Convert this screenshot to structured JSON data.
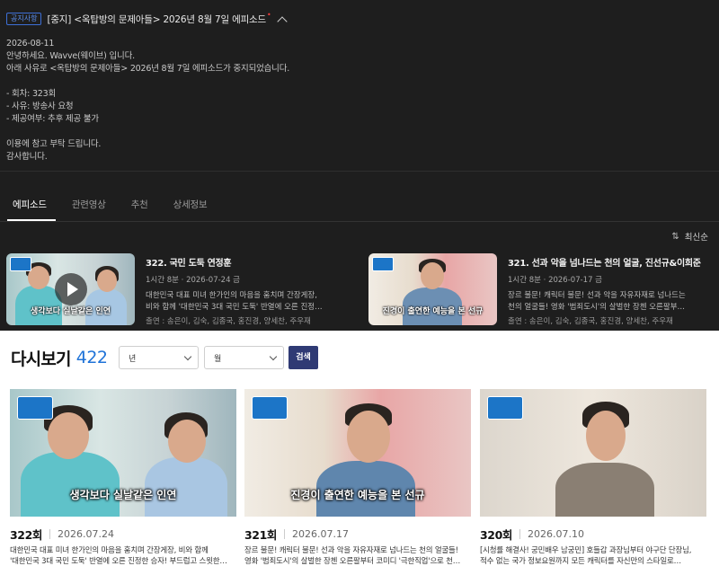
{
  "notice": {
    "badge": "공지사항",
    "title": "[중지] <옥탑방의 문제아들> 2026년 8월 7일 에피소드",
    "new_mark": "•",
    "lines": [
      "2026-08-11",
      "안녕하세요. Wavve(웨이브) 입니다.",
      "아래 사유로 <옥탑방의 문제아들> 2026년 8월 7일 에피소드가 중지되었습니다.",
      "",
      "- 회차: 323회",
      "- 사유: 방송사 요청",
      "- 제공여부: 추후 제공 불가",
      "",
      "이용에 참고 부탁 드립니다.",
      "감사합니다."
    ]
  },
  "tabs": [
    "에피소드",
    "관련영상",
    "추천",
    "상세정보"
  ],
  "sort": {
    "icon": "sort-icon",
    "label": "최신순"
  },
  "episodes": [
    {
      "title": "322. 국민 도둑 연정훈",
      "meta": "1시간 8분 · 2026-07-24 금",
      "desc1": "대한민국 대표 미녀 한가인의 마음을 훔치며 간장게장,",
      "desc2": "비와 함께 '대한민국 3대 국민 도둑' 반열에 오른 진정…",
      "cast": "출연 : 송은이, 김숙, 김종국, 홍진경, 양세찬, 주우재",
      "thumb_caption": "생각보다 실날같은 인연"
    },
    {
      "title": "321. 선과 악을 넘나드는 천의 얼굴, 진선규&이희준",
      "meta": "1시간 8분 · 2026-07-17 금",
      "desc1": "장르 불문! 캐릭터 불문! 선과 악을 자유자재로 넘나드는",
      "desc2": "천의 얼굴들! 영화 '범죄도시'의 살벌한 장첸 오른팔부…",
      "cast": "출연 : 송은이, 김숙, 김종국, 홍진경, 양세찬, 주우재",
      "thumb_caption": "진경이 출연한 예능을 본 선규"
    }
  ],
  "replay": {
    "title": "다시보기",
    "count": "422",
    "year_select": "년",
    "month_select": "월",
    "search_label": "검색"
  },
  "vods": [
    {
      "ep": "322회",
      "date": "2026.07.24",
      "desc1": "대한민국 대표 미녀 한가인의 마음을 훔치며 간장게장, 비와 함께",
      "desc2": "'대한민국 3대 국민 도둑' 반열에 오른 진정한 승자! 부드럽고 스윗한…",
      "caption": "생각보다 실날같은 인연"
    },
    {
      "ep": "321회",
      "date": "2026.07.17",
      "desc1": "장르 불문! 캐릭터 불문! 선과 악을 자유자재로 넘나드는 천의 얼굴들!",
      "desc2": "영화 '범죄도시'의 살벌한 장첸 오른팔부터 코미디 '극한직업'으로 천…",
      "caption": "진경이 출연한 예능을 본 선규"
    },
    {
      "ep": "320회",
      "date": "2026.07.10",
      "desc1": "[시청률 해결사! 궁민배우 남궁민] 호들갑 과장님부터 야구단 단장님,",
      "desc2": "적수 없는 국가 정보요원까지 모든 캐릭터를 자신만의 스타일로…",
      "caption": ""
    }
  ],
  "colors": {
    "accent": "#1f73d8",
    "search_button": "#2f3a74",
    "dark_bg": "#1e1e1e",
    "badge": "#3d6fd6"
  }
}
